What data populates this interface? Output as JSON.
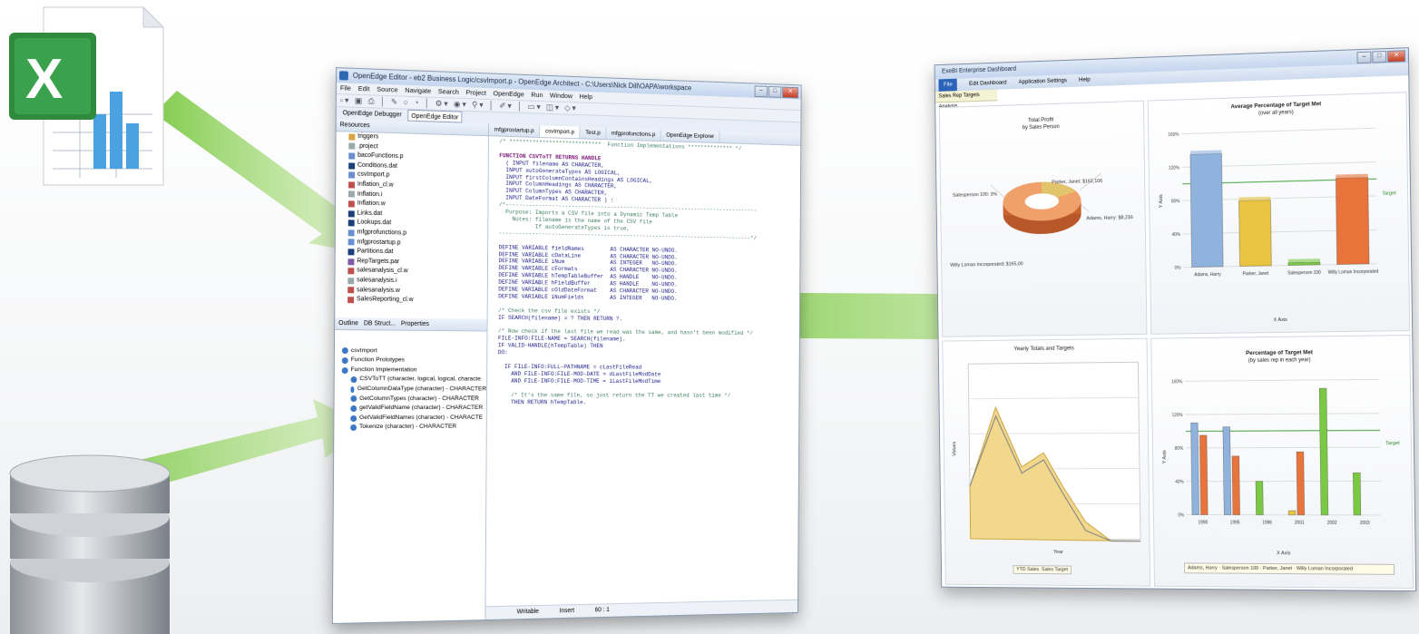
{
  "editor": {
    "window_title": "OpenEdge Editor - eb2 Business Logic/csvImport.p - OpenEdge Architect - C:\\Users\\Nick Dill\\OAPA\\workspace",
    "menu": [
      "File",
      "Edit",
      "Source",
      "Navigate",
      "Search",
      "Project",
      "OpenEdge",
      "Run",
      "Window",
      "Help"
    ],
    "perspectives": [
      "OpenEdge Debugger",
      "OpenEdge Editor"
    ],
    "resources_tab": "Resources",
    "resources": [
      "triggers",
      ".project",
      "bacoFunctions.p",
      "Conditions.dat",
      "csvImport.p",
      "Inflation_cl.w",
      "Inflation.i",
      "Inflation.w",
      "Links.dat",
      "Lookups.dat",
      "mfgprofunctions.p",
      "mfgprostartup.p",
      "Partitions.dat",
      "RepTargets.par",
      "salesanalysis_cl.w",
      "salesanalysis.i",
      "salesanalysis.w",
      "SalesReporting_cl.w"
    ],
    "outline_tabs": [
      "Outline",
      "DB Struct...",
      "Properties"
    ],
    "outline": [
      "csvImport",
      "Function Prototypes",
      "Function Implementation",
      "CSVToTT (character, logical, logical, characte",
      "GetColumnDataType (character) - CHARACTER",
      "GetColumnTypes (character) - CHARACTER",
      "getValidFieldName (character) - CHARACTER",
      "GetValidFieldNames (character) - CHARACTE",
      "Tokenize (character) - CHARACTER"
    ],
    "editor_tabs": [
      "mfgprostartup.p",
      "csvImport.p",
      "Test.p",
      "mfgprofunctions.p",
      "OpenEdge Explorer"
    ],
    "code_lines": [
      {
        "t": "/* ****************************  Function Implementations ************** */",
        "c": "cm"
      },
      {
        "t": "",
        "c": ""
      },
      {
        "t": "FUNCTION CSVToTT RETURNS HANDLE",
        "c": "kw"
      },
      {
        "t": "  ( INPUT filename AS CHARACTER,",
        "c": ""
      },
      {
        "t": "  INPUT autoGenerateTypes AS LOGICAL,",
        "c": ""
      },
      {
        "t": "  INPUT firstColumnContainsHeadings AS LOGICAL,",
        "c": ""
      },
      {
        "t": "  INPUT ColumnHeadings AS CHARACTER,",
        "c": ""
      },
      {
        "t": "  INPUT ColumnTypes AS CHARACTER,",
        "c": ""
      },
      {
        "t": "  INPUT DateFormat AS CHARACTER ) :",
        "c": ""
      },
      {
        "t": "/*------------------------------------------------------------------------------",
        "c": "cm"
      },
      {
        "t": "  Purpose: Imports a CSV file into a Dynamic Temp Table",
        "c": "cm"
      },
      {
        "t": "    Notes: filename is the name of the CSV file",
        "c": "cm"
      },
      {
        "t": "           If autoGenerateTypes is true,",
        "c": "cm"
      },
      {
        "t": "------------------------------------------------------------------------------*/",
        "c": "cm"
      },
      {
        "t": "",
        "c": ""
      },
      {
        "t": "DEFINE VARIABLE fieldNames        AS CHARACTER NO-UNDO.",
        "c": ""
      },
      {
        "t": "DEFINE VARIABLE cDataLine         AS CHARACTER NO-UNDO.",
        "c": ""
      },
      {
        "t": "DEFINE VARIABLE iNum              AS INTEGER   NO-UNDO.",
        "c": ""
      },
      {
        "t": "DEFINE VARIABLE cFormats          AS CHARACTER NO-UNDO.",
        "c": ""
      },
      {
        "t": "DEFINE VARIABLE hTempTableBuffer  AS HANDLE    NO-UNDO.",
        "c": ""
      },
      {
        "t": "DEFINE VARIABLE hFieldBuffer      AS HANDLE    NO-UNDO.",
        "c": ""
      },
      {
        "t": "DEFINE VARIABLE cOldDateFormat    AS CHARACTER NO-UNDO.",
        "c": ""
      },
      {
        "t": "DEFINE VARIABLE iNumFields        AS INTEGER   NO-UNDO.",
        "c": ""
      },
      {
        "t": "",
        "c": ""
      },
      {
        "t": "/* Check the csv file exists */",
        "c": "cm"
      },
      {
        "t": "IF SEARCH(filename) = ? THEN RETURN ?.",
        "c": ""
      },
      {
        "t": "",
        "c": ""
      },
      {
        "t": "/* Now check if the last file we read was the same, and hasn't been modified */",
        "c": "cm"
      },
      {
        "t": "FILE-INFO:FILE-NAME = SEARCH(filename).",
        "c": ""
      },
      {
        "t": "IF VALID-HANDLE(hTempTable) THEN",
        "c": ""
      },
      {
        "t": "DO:",
        "c": ""
      },
      {
        "t": "",
        "c": ""
      },
      {
        "t": "  IF FILE-INFO:FULL-PATHNAME = cLastFileRead",
        "c": ""
      },
      {
        "t": "    AND FILE-INFO:FILE-MOD-DATE = dLastFileModDate",
        "c": ""
      },
      {
        "t": "    AND FILE-INFO:FILE-MOD-TIME = iLastFileModTime",
        "c": ""
      },
      {
        "t": "",
        "c": ""
      },
      {
        "t": "    /* It's the same file, so just return the TT we created last time */",
        "c": "cm"
      },
      {
        "t": "    THEN RETURN hTempTable.",
        "c": ""
      }
    ],
    "status": [
      "Writable",
      "Insert",
      "60 : 1"
    ]
  },
  "dashboard": {
    "window_title": "ExeBI Enterprise Dashboard",
    "menu": [
      "File",
      "Edit Dashboard",
      "Application Settings",
      "Help"
    ],
    "tab": "Sales Rep Targets Analysis",
    "donut": {
      "title": "Total Profit",
      "subtitle": "by Sales Person",
      "labels": [
        "Parker, Janet: $162,106",
        "Salesperson 100: 3%",
        "Adams, Harry: $8,216",
        "Willy Loman Incorporated: $165,00"
      ]
    },
    "bar1": {
      "title": "Average Percentage of Target Met",
      "subtitle": "(over all years)",
      "ylabel": "Y Axis",
      "xlabel": "X Axis",
      "target_label": "Target"
    },
    "area": {
      "title": "Yearly Totals and Targets",
      "ylabel": "Values",
      "xlabel": "Year",
      "legend": [
        "YTD Sales",
        "Sales Target"
      ]
    },
    "bar2": {
      "title": "Percentage of Target Met",
      "subtitle": "(by sales rep in each year)",
      "ylabel": "Y Axis",
      "xlabel": "X Axis",
      "target_label": "Target",
      "legend": [
        "Adams, Harry",
        "Salesperson 100",
        "Parker, Janet",
        "Willy Loman Incorporated"
      ]
    }
  },
  "chart_data": [
    {
      "type": "bar",
      "title": "Average Percentage of Target Met",
      "subtitle": "(over all years)",
      "categories": [
        "Adams, Harry",
        "Parker, Janet",
        "Salesperson 100",
        "Willy Loman Incorporated"
      ],
      "values": [
        135,
        78,
        3,
        102
      ],
      "ylim": [
        0,
        160
      ],
      "yticks": [
        "0%",
        "40%",
        "80%",
        "120%",
        "160%"
      ],
      "xlabel": "X Axis",
      "ylabel": "Y Axis",
      "target": 100
    },
    {
      "type": "bar",
      "title": "Percentage of Target Met",
      "subtitle": "(by sales rep in each year)",
      "categories": [
        "1990",
        "1995",
        "1996",
        "2001",
        "2002",
        "2003"
      ],
      "series": [
        {
          "name": "Adams, Harry",
          "values": [
            110,
            105,
            0,
            0,
            0,
            0
          ]
        },
        {
          "name": "Salesperson 100",
          "values": [
            0,
            0,
            0,
            5,
            0,
            0
          ]
        },
        {
          "name": "Parker, Janet",
          "values": [
            95,
            70,
            0,
            75,
            0,
            0
          ]
        },
        {
          "name": "Willy Loman Incorporated",
          "values": [
            0,
            0,
            40,
            0,
            150,
            50
          ]
        }
      ],
      "ylim": [
        0,
        160
      ],
      "yticks": [
        "0%",
        "40%",
        "80%",
        "120%",
        "160%"
      ],
      "xlabel": "X Axis",
      "ylabel": "Y Axis",
      "target": 100
    }
  ]
}
